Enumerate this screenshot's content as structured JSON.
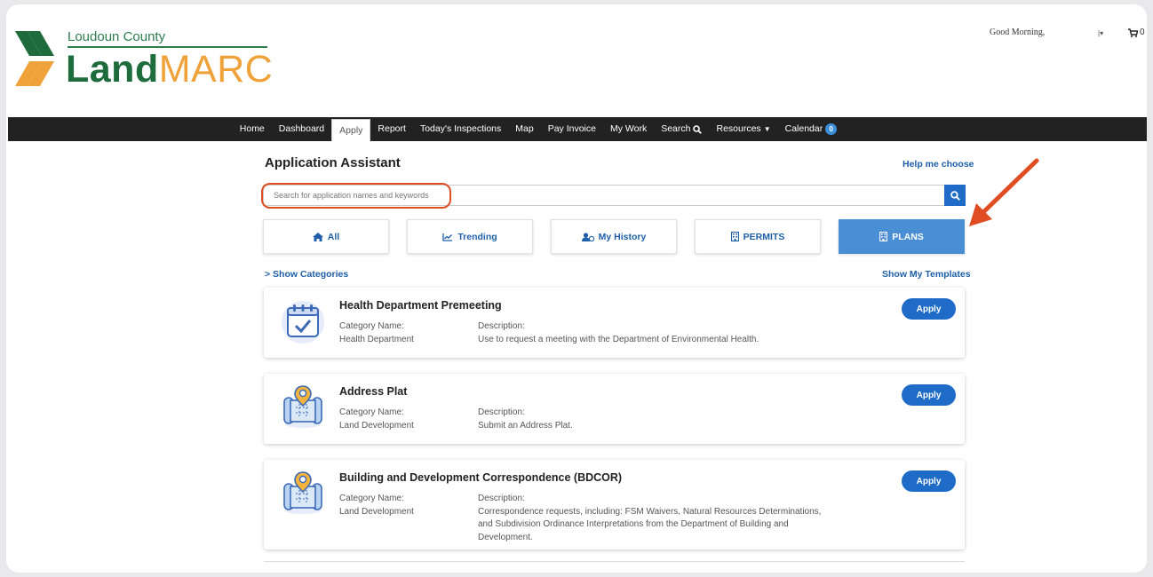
{
  "header": {
    "logo_county": "Loudoun County",
    "logo_land": "Land",
    "logo_marc": "MARC",
    "greeting": "Good Morning,",
    "cart_count": "0"
  },
  "nav": {
    "items": [
      {
        "label": "Home"
      },
      {
        "label": "Dashboard"
      },
      {
        "label": "Apply",
        "active": true
      },
      {
        "label": "Report"
      },
      {
        "label": "Today's Inspections"
      },
      {
        "label": "Map"
      },
      {
        "label": "Pay Invoice"
      },
      {
        "label": "My Work"
      },
      {
        "label": "Search"
      },
      {
        "label": "Resources"
      },
      {
        "label": "Calendar"
      }
    ],
    "calendar_badge": "0"
  },
  "assistant": {
    "title": "Application Assistant",
    "help_link": "Help me choose",
    "search_placeholder": "Search for application names and keywords",
    "filters": [
      {
        "label": "All",
        "icon": "home-icon"
      },
      {
        "label": "Trending",
        "icon": "trending-icon"
      },
      {
        "label": "My History",
        "icon": "user-history-icon"
      },
      {
        "label": "PERMITS",
        "icon": "building-icon"
      },
      {
        "label": "PLANS",
        "icon": "building-icon",
        "selected": true
      }
    ],
    "show_categories": "> Show Categories",
    "show_templates": "Show My Templates"
  },
  "cards": [
    {
      "title": "Health Department Premeeting",
      "category_label": "Category Name:",
      "category": "Health Department",
      "description_label": "Description:",
      "description": "Use to request a meeting with the Department of Environmental Health.",
      "icon": "calendar-check-icon",
      "apply_label": "Apply"
    },
    {
      "title": "Address Plat",
      "category_label": "Category Name:",
      "category": "Land Development",
      "description_label": "Description:",
      "description": "Submit an Address Plat.",
      "icon": "map-pin-icon",
      "apply_label": "Apply"
    },
    {
      "title": "Building and Development Correspondence (BDCOR)",
      "category_label": "Category Name:",
      "category": "Land Development",
      "description_label": "Description:",
      "description": "Correspondence requests, including: FSM Waivers, Natural Resources Determinations, and Subdivision Ordinance Interpretations from the Department of Building and Development.",
      "icon": "map-pin-icon",
      "apply_label": "Apply"
    }
  ],
  "colors": {
    "brand_green": "#1e6b3c",
    "brand_orange": "#f0a23a",
    "link_blue": "#1e5fa8",
    "button_blue": "#1e6cc8",
    "selected_filter": "#4a8fd6",
    "annotation_red": "#e04d23"
  }
}
